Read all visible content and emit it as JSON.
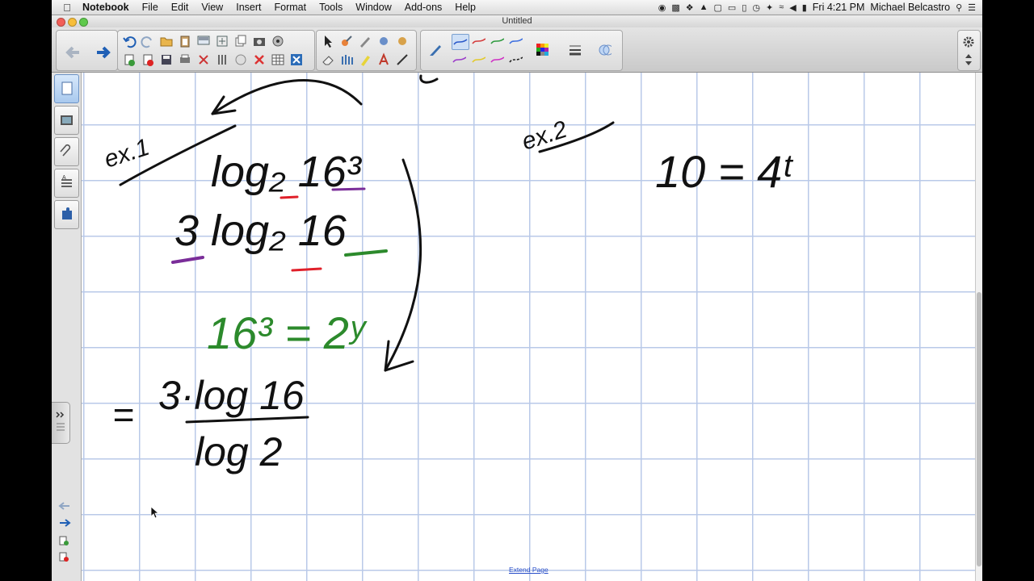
{
  "menubar": {
    "app_name": "Notebook",
    "menus": [
      "File",
      "Edit",
      "View",
      "Insert",
      "Format",
      "Tools",
      "Window",
      "Add-ons",
      "Help"
    ],
    "clock": "Fri 4:21 PM",
    "user": "Michael Belcastro"
  },
  "window": {
    "title": "Untitled"
  },
  "sidebar": {
    "tabs": [
      "page-sorter-icon",
      "gallery-icon",
      "attachments-icon",
      "properties-icon",
      "add-ons-icon"
    ]
  },
  "page": {
    "extend_link": "Extend Page",
    "handwriting": {
      "ex1_label": "ex.1",
      "ex2_label": "ex.2",
      "line1": "log₂ 16³",
      "line2": "3 log₂ 16",
      "line3": "16³ = 2ʸ",
      "line4_numerator": "3·log 16",
      "line4_denominator": "log 2",
      "line5": "10 = 4ᵗ"
    }
  },
  "colors": {
    "ink_black": "#111111",
    "ink_red": "#e0202a",
    "ink_purple": "#7a2d99",
    "ink_green": "#2c8a2c",
    "ink_blue": "#1f2fe0",
    "grid": "#b9c9e8"
  }
}
